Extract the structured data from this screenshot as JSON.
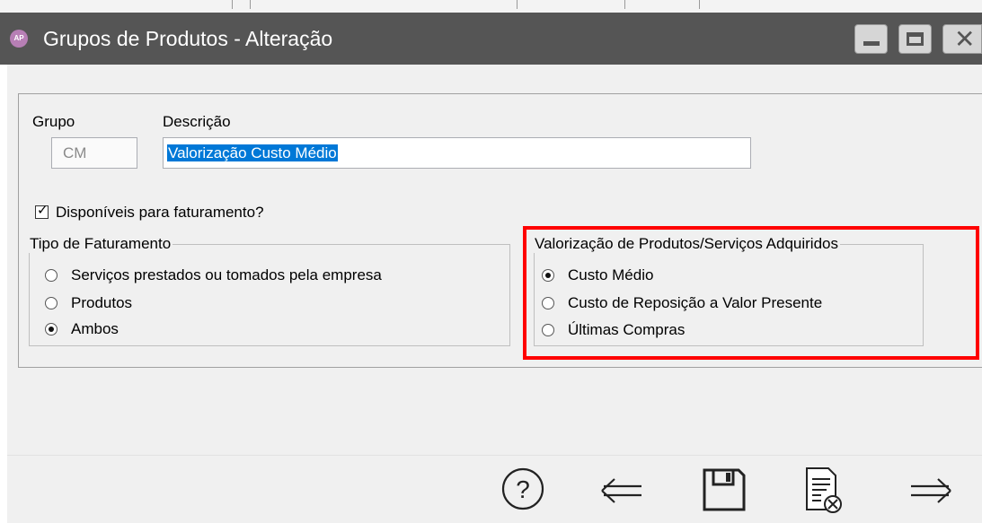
{
  "window": {
    "app_badge": "AP",
    "title": "Grupos de Produtos - Alteração",
    "controls": [
      "minimize-icon",
      "maximize-icon",
      "close-icon"
    ]
  },
  "form": {
    "grupo_label": "Grupo",
    "grupo_value": "CM",
    "descricao_label": "Descrição",
    "descricao_value": "Valorização Custo Médio",
    "checkbox_label": "Disponíveis para faturamento?",
    "checkbox_checked": true
  },
  "tipo_faturamento": {
    "title": "Tipo de Faturamento",
    "options": [
      {
        "label": "Serviços prestados ou tomados pela empresa",
        "selected": false
      },
      {
        "label": "Produtos",
        "selected": false
      },
      {
        "label": "Ambos",
        "selected": true
      }
    ]
  },
  "valorizacao": {
    "title": "Valorização de Produtos/Serviços Adquiridos",
    "options": [
      {
        "label": "Custo Médio",
        "selected": true
      },
      {
        "label": "Custo de Reposição a Valor Presente",
        "selected": false
      },
      {
        "label": "Últimas Compras",
        "selected": false
      }
    ],
    "highlight_color": "#ff0000"
  },
  "toolbar": {
    "buttons": [
      "help-icon",
      "back-arrow-icon",
      "save-icon",
      "cancel-document-icon",
      "forward-arrow-icon"
    ]
  },
  "colors": {
    "titlebar": "#555555",
    "panel": "#f0f0f0",
    "selection": "#0078d7"
  }
}
